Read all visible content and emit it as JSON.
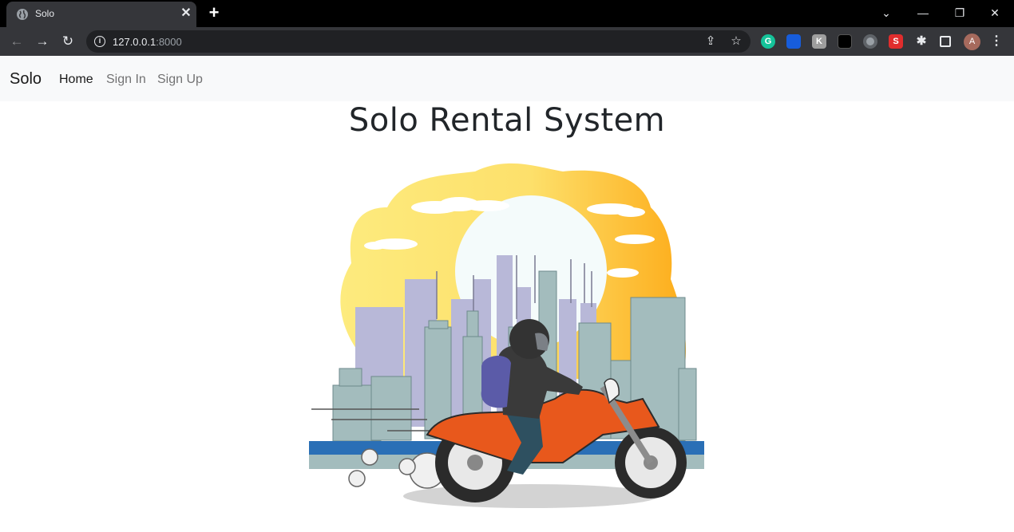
{
  "browser": {
    "tab_title": "Solo",
    "url_host": "127.0.0.1",
    "url_port": ":8000",
    "extensions": [
      {
        "name": "grammarly",
        "letter": "G",
        "color": "#15c39a"
      },
      {
        "name": "bitwarden",
        "letter": "",
        "color": "#175ddc"
      },
      {
        "name": "k-extension",
        "letter": "K",
        "color": "#9e9e9e"
      },
      {
        "name": "lock-extension",
        "letter": "",
        "color": "#000000"
      },
      {
        "name": "record-extension",
        "letter": "",
        "color": "#9aa0a6"
      },
      {
        "name": "s-extension",
        "letter": "S",
        "color": "#e12d2d"
      }
    ],
    "profile_initial": "A"
  },
  "navbar": {
    "brand": "Solo",
    "links": [
      {
        "label": "Home",
        "active": true
      },
      {
        "label": "Sign In",
        "active": false
      },
      {
        "label": "Sign Up",
        "active": false
      }
    ]
  },
  "main": {
    "title": "Solo Rental System",
    "hero_image": "motorcycle-rider-city-illustration"
  },
  "colors": {
    "navbar_bg": "#f8f9fa",
    "sky_yellow": "#fde06b",
    "sky_orange": "#fdb21e",
    "building_teal": "#a3bcbd",
    "building_lavender": "#b7b7d6",
    "motorcycle_orange": "#e8581c"
  }
}
